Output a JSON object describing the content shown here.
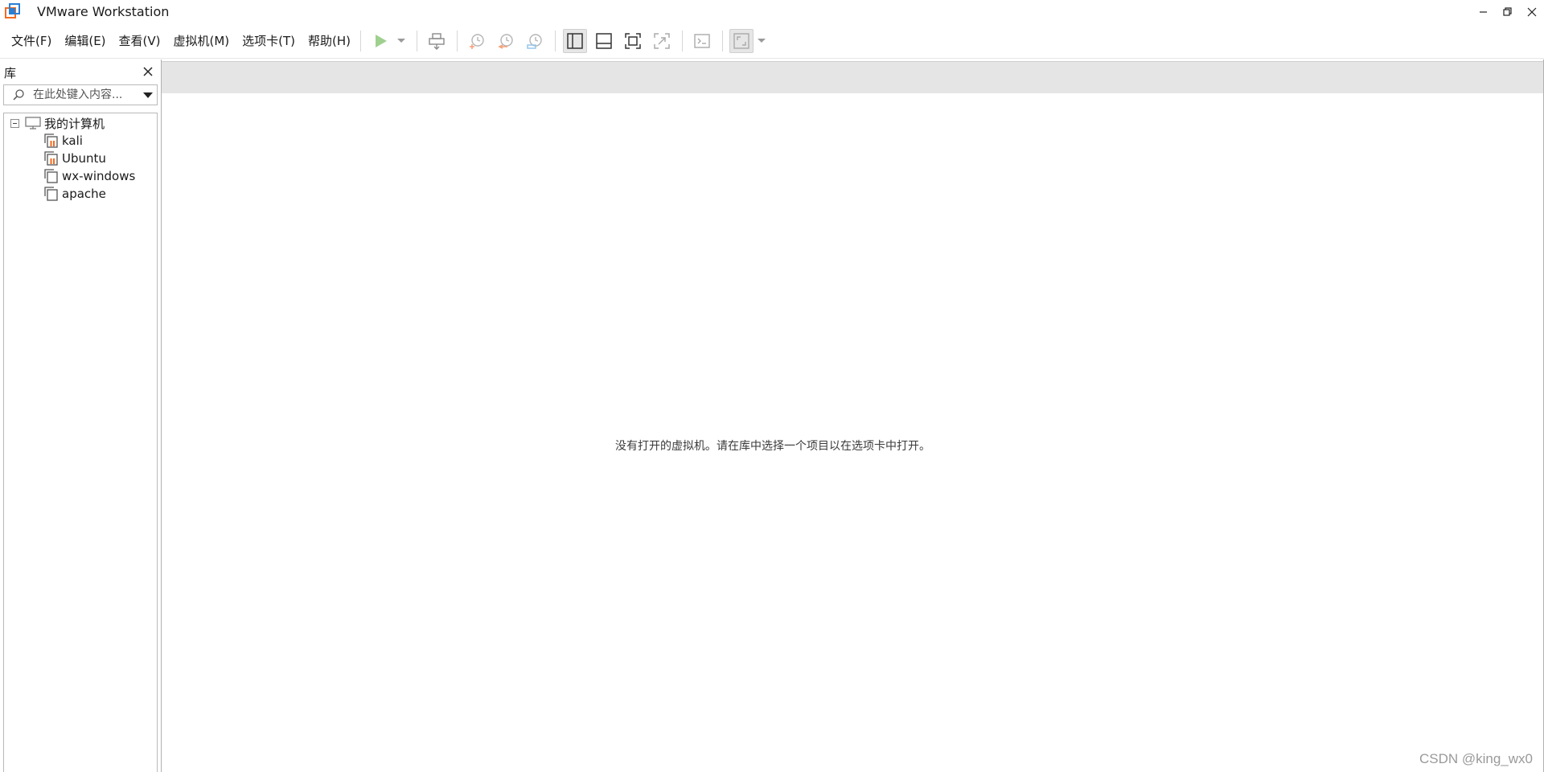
{
  "window": {
    "title": "VMware Workstation"
  },
  "menu": [
    {
      "label": "文件(F)"
    },
    {
      "label": "编辑(E)"
    },
    {
      "label": "查看(V)"
    },
    {
      "label": "虚拟机(M)"
    },
    {
      "label": "选项卡(T)"
    },
    {
      "label": "帮助(H)"
    }
  ],
  "toolbar": {
    "icons": [
      "power-on-icon",
      "send-ctrl-alt-del-icon",
      "take-snapshot-icon",
      "revert-snapshot-icon",
      "snapshot-manager-icon",
      "show-library-icon",
      "show-thumbnail-bar-icon",
      "full-screen-icon",
      "unity-icon",
      "console-view-icon",
      "stretch-guest-icon"
    ]
  },
  "library": {
    "title": "库",
    "search_placeholder": "在此处键入内容...",
    "root": {
      "label": "我的计算机",
      "icon": "computer-icon"
    },
    "vms": [
      {
        "label": "kali",
        "icon": "vm-paused-icon"
      },
      {
        "label": "Ubuntu",
        "icon": "vm-paused-icon"
      },
      {
        "label": "wx-windows",
        "icon": "vm-icon"
      },
      {
        "label": "apache",
        "icon": "vm-icon"
      }
    ]
  },
  "main": {
    "empty_message": "没有打开的虚拟机。请在库中选择一个项目以在选项卡中打开。"
  },
  "watermark": "CSDN @king_wx0",
  "colors": {
    "accent_orange": "#f26b21",
    "accent_blue": "#2a7fd4",
    "play_green": "#7ac36a",
    "tabstrip_bg": "#e5e5e5"
  }
}
